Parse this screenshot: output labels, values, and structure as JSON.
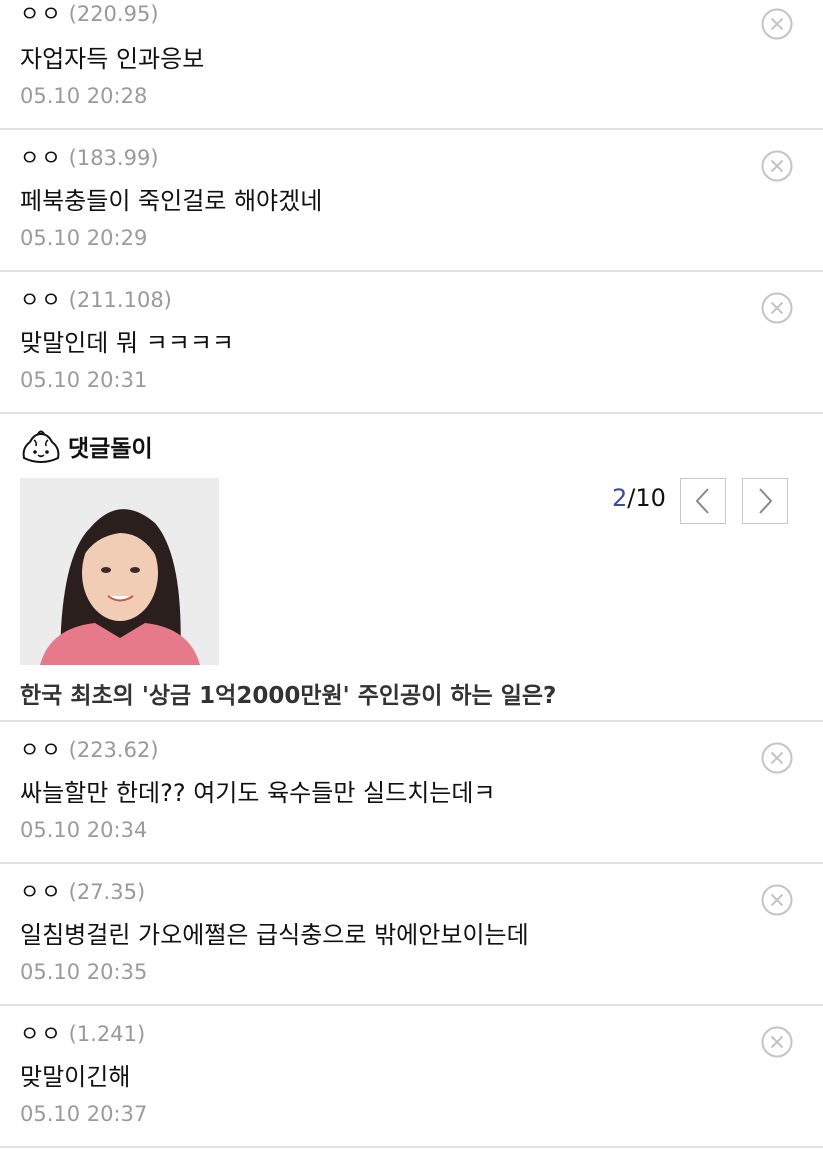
{
  "comments_top": [
    {
      "nick": "ㅇㅇ",
      "ip": "(220.95)",
      "text": "자업자득 인과응보",
      "time": "05.10 20:28"
    },
    {
      "nick": "ㅇㅇ",
      "ip": "(183.99)",
      "text": "페북충들이 죽인걸로 해야겠네",
      "time": "05.10 20:29"
    },
    {
      "nick": "ㅇㅇ",
      "ip": "(211.108)",
      "text": "맞말인데 뭐 ㅋㅋㅋㅋ",
      "time": "05.10 20:31"
    }
  ],
  "bot": {
    "title": "댓글돌이",
    "page_current": "2",
    "page_total": "/10",
    "headline": "한국 최초의 '상금 1억2000만원' 주인공이 하는 일은?",
    "icon": "dumpling-mascot-icon"
  },
  "comments_bottom": [
    {
      "nick": "ㅇㅇ",
      "ip": "(223.62)",
      "text": "싸늘할만 한데?? 여기도 육수들만 실드치는데ㅋ",
      "time": "05.10 20:34"
    },
    {
      "nick": "ㅇㅇ",
      "ip": "(27.35)",
      "text": "일침병걸린 가오에쩔은 급식충으로 밖에안보이는데",
      "time": "05.10 20:35"
    },
    {
      "nick": "ㅇㅇ",
      "ip": "(1.241)",
      "text": "맞말이긴해",
      "time": "05.10 20:37"
    }
  ],
  "colors": {
    "accent": "#3a4aa0",
    "muted": "#9b9b9b",
    "divider": "#e2e2e2"
  }
}
